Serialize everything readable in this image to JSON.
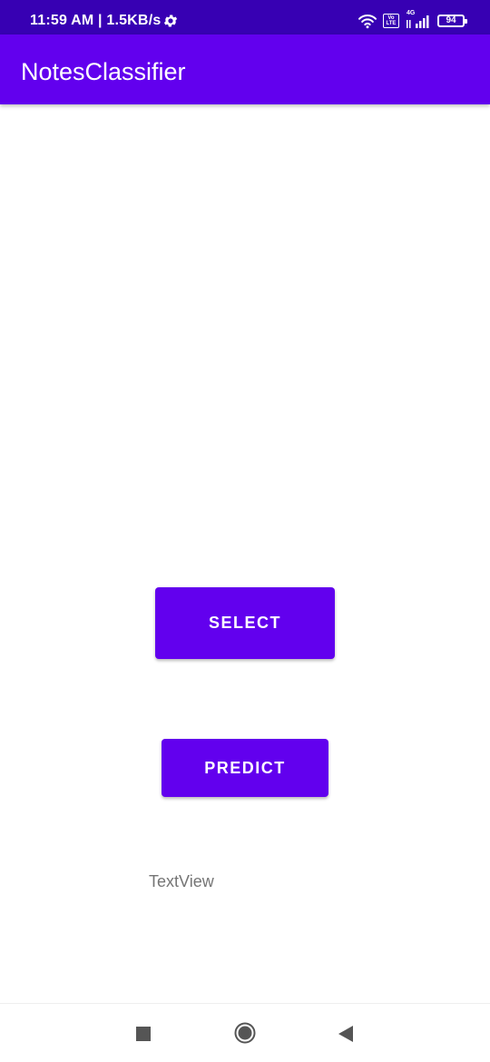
{
  "status_bar": {
    "time": "11:59 AM | 1.5KB/s",
    "battery": "94",
    "volte": "Vo LTE",
    "network": "4G"
  },
  "app_bar": {
    "title": "NotesClassifier"
  },
  "main": {
    "select_label": "SELECT",
    "predict_label": "PREDICT",
    "text_view": "TextView"
  },
  "colors": {
    "primary": "#6200ee",
    "primary_dark": "#3700b3",
    "text_secondary": "#757575"
  },
  "icons": {
    "settings": "gear-icon",
    "wifi": "wifi-icon",
    "signal": "signal-icon",
    "recent": "recent-apps-icon",
    "home": "home-icon",
    "back": "back-icon"
  }
}
